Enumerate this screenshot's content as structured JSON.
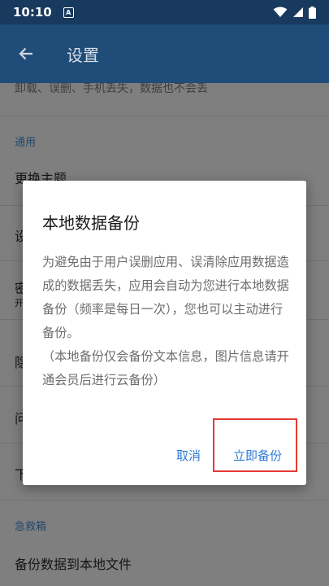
{
  "status_bar": {
    "time": "10:10",
    "indicator": "A"
  },
  "toolbar": {
    "title": "设置"
  },
  "settings": {
    "partial_desc": "卸载、误删、手机丢失，数据也不会丢",
    "section_general": "通用",
    "item_theme": "更换主题",
    "partial_items": [
      "设",
      "密",
      "开",
      "隐",
      "问",
      "下"
    ],
    "section_rescue": "急救箱",
    "item_backup_file": "备份数据到本地文件"
  },
  "dialog": {
    "title": "本地数据备份",
    "body_1": "为避免由于用户误删应用、误清除应用数据造成的数据丢失，应用会自动为您进行本地数据备份（频率是每日一次），您也可以主动进行备份。",
    "body_2": "（本地备份仅会备份文本信息，图片信息请开通会员后进行云备份）",
    "cancel_label": "取消",
    "backup_label": "立即备份"
  },
  "colors": {
    "status_bar": "#173a5e",
    "toolbar": "#1f4c78",
    "accent": "#2f7bd6",
    "highlight": "#e53935"
  },
  "icons": {
    "back": "arrow-left-icon",
    "wifi": "wifi-icon",
    "signal": "signal-icon",
    "battery": "battery-icon"
  }
}
